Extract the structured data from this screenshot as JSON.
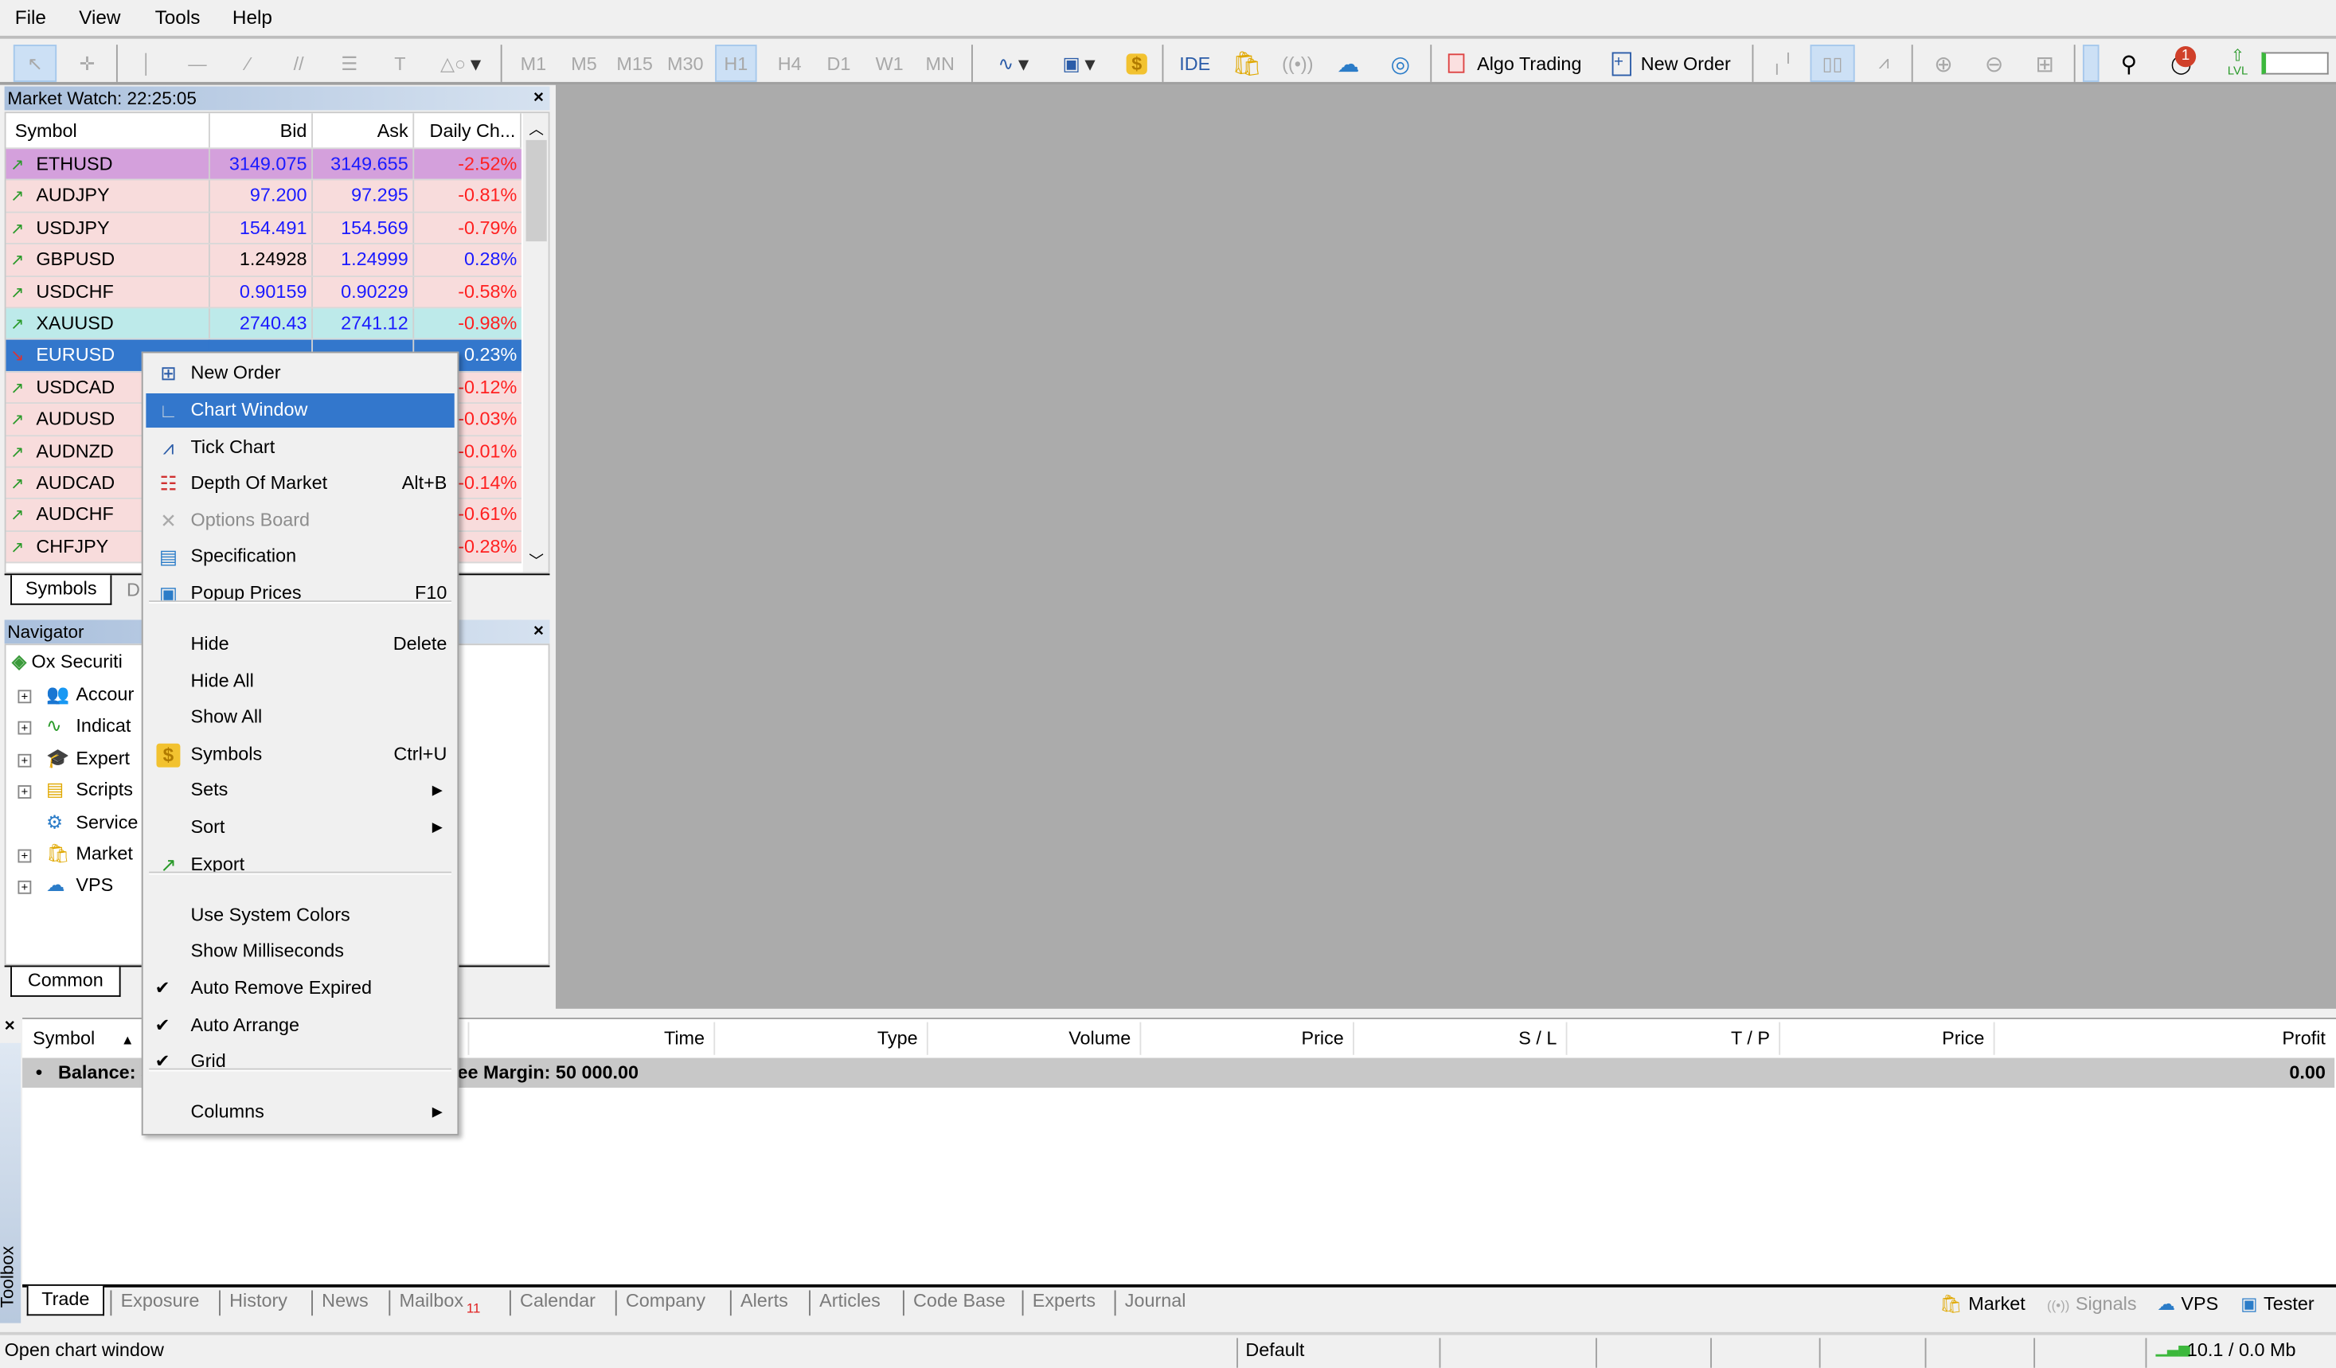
{
  "menu": [
    "File",
    "View",
    "Tools",
    "Help"
  ],
  "toolbar": {
    "timeframes": [
      "M1",
      "M5",
      "M15",
      "M30",
      "H1",
      "H4",
      "D1",
      "W1",
      "MN"
    ],
    "selected_timeframe": "H1",
    "ide": "IDE",
    "algo_trading": "Algo Trading",
    "new_order": "New Order",
    "notification_count": "1",
    "lvl": "LVL"
  },
  "market_watch": {
    "title": "Market Watch: 22:25:05",
    "columns": [
      "Symbol",
      "Bid",
      "Ask",
      "Daily Ch..."
    ],
    "rows": [
      {
        "symbol": "ETHUSD",
        "bid": "3149.075",
        "ask": "3149.655",
        "change": "-2.52%",
        "bg": "#d4a0dc",
        "dir": "up"
      },
      {
        "symbol": "AUDJPY",
        "bid": "97.200",
        "ask": "97.295",
        "change": "-0.81%",
        "bg": "#f8dcdc",
        "dir": "up"
      },
      {
        "symbol": "USDJPY",
        "bid": "154.491",
        "ask": "154.569",
        "change": "-0.79%",
        "bg": "#f8dcdc",
        "dir": "up"
      },
      {
        "symbol": "GBPUSD",
        "bid": "1.24928",
        "ask": "1.24999",
        "change": "0.28%",
        "bg": "#f8dcdc",
        "dir": "up"
      },
      {
        "symbol": "USDCHF",
        "bid": "0.90159",
        "ask": "0.90229",
        "change": "-0.58%",
        "bg": "#f8dcdc",
        "dir": "up"
      },
      {
        "symbol": "XAUUSD",
        "bid": "2740.43",
        "ask": "2741.12",
        "change": "-0.98%",
        "bg": "#bdeaea",
        "dir": "up"
      },
      {
        "symbol": "EURUSD",
        "bid": "",
        "ask": "",
        "change": "0.23%",
        "bg": "#3377cc",
        "dir": "down",
        "selected": true
      },
      {
        "symbol": "USDCAD",
        "bid": "",
        "ask": "",
        "change": "-0.12%",
        "bg": "#f8dcdc",
        "dir": "up"
      },
      {
        "symbol": "AUDUSD",
        "bid": "",
        "ask": "",
        "change": "-0.03%",
        "bg": "#f8dcdc",
        "dir": "up"
      },
      {
        "symbol": "AUDNZD",
        "bid": "",
        "ask": "",
        "change": "-0.01%",
        "bg": "#f8dcdc",
        "dir": "up"
      },
      {
        "symbol": "AUDCAD",
        "bid": "",
        "ask": "",
        "change": "-0.14%",
        "bg": "#f8dcdc",
        "dir": "up"
      },
      {
        "symbol": "AUDCHF",
        "bid": "",
        "ask": "",
        "change": "-0.61%",
        "bg": "#f8dcdc",
        "dir": "up"
      },
      {
        "symbol": "CHFJPY",
        "bid": "",
        "ask": "",
        "change": "-0.28%",
        "bg": "#f8dcdc",
        "dir": "up"
      }
    ],
    "tabs": [
      "Symbols",
      "D"
    ]
  },
  "navigator": {
    "title": "Navigator",
    "root": "Ox Securiti",
    "items": [
      {
        "label": "Accour",
        "icon": "accounts-icon"
      },
      {
        "label": "Indicat",
        "icon": "indicators-icon"
      },
      {
        "label": "Expert",
        "icon": "experts-icon"
      },
      {
        "label": "Scripts",
        "icon": "scripts-icon"
      },
      {
        "label": "Service",
        "icon": "services-icon"
      },
      {
        "label": "Market",
        "icon": "market-icon"
      },
      {
        "label": "VPS",
        "icon": "vps-icon"
      }
    ],
    "tabs": [
      "Common"
    ]
  },
  "context_menu": [
    {
      "label": "New Order",
      "icon": "new-order-icon"
    },
    {
      "label": "Chart Window",
      "icon": "chart-window-icon",
      "highlighted": true
    },
    {
      "label": "Tick Chart",
      "icon": "tick-chart-icon"
    },
    {
      "label": "Depth Of Market",
      "shortcut": "Alt+B",
      "icon": "depth-of-market-icon"
    },
    {
      "label": "Options Board",
      "icon": "options-board-icon",
      "disabled": true
    },
    {
      "label": "Specification",
      "icon": "specification-icon"
    },
    {
      "label": "Popup Prices",
      "shortcut": "F10",
      "icon": "popup-prices-icon"
    },
    {
      "separator": true
    },
    {
      "label": "Hide",
      "shortcut": "Delete"
    },
    {
      "label": "Hide All"
    },
    {
      "label": "Show All"
    },
    {
      "label": "Symbols",
      "shortcut": "Ctrl+U",
      "icon": "symbols-icon"
    },
    {
      "label": "Sets",
      "submenu": true
    },
    {
      "label": "Sort",
      "submenu": true
    },
    {
      "label": "Export",
      "icon": "export-icon"
    },
    {
      "separator": true
    },
    {
      "label": "Use System Colors"
    },
    {
      "label": "Show Milliseconds"
    },
    {
      "label": "Auto Remove Expired",
      "checked": true
    },
    {
      "label": "Auto Arrange",
      "checked": true
    },
    {
      "label": "Grid",
      "checked": true
    },
    {
      "separator": true
    },
    {
      "label": "Columns",
      "submenu": true
    }
  ],
  "toolbox": {
    "label": "Toolbox",
    "columns": [
      "Symbol",
      "Time",
      "Type",
      "Volume",
      "Price",
      "S / L",
      "T / P",
      "Price",
      "Profit"
    ],
    "balance_left": "Balance: 5",
    "balance_right": "ee Margin: 50 000.00",
    "profit": "0.00",
    "tabs": [
      "Trade",
      "Exposure",
      "History",
      "News",
      "Mailbox",
      "Calendar",
      "Company",
      "Alerts",
      "Articles",
      "Code Base",
      "Experts",
      "Journal"
    ],
    "mailbox_count": "11",
    "active_tab": "Trade",
    "right_buttons": [
      "Market",
      "Signals",
      "VPS",
      "Tester"
    ]
  },
  "status": {
    "message": "Open chart window",
    "profile": "Default",
    "traffic": "10.1 / 0.0 Mb"
  },
  "colors": {
    "accent": "#3377cc",
    "chart_bg": "#ababab",
    "bid_blue": "#1a1aff",
    "neg_red": "#ff2020"
  }
}
